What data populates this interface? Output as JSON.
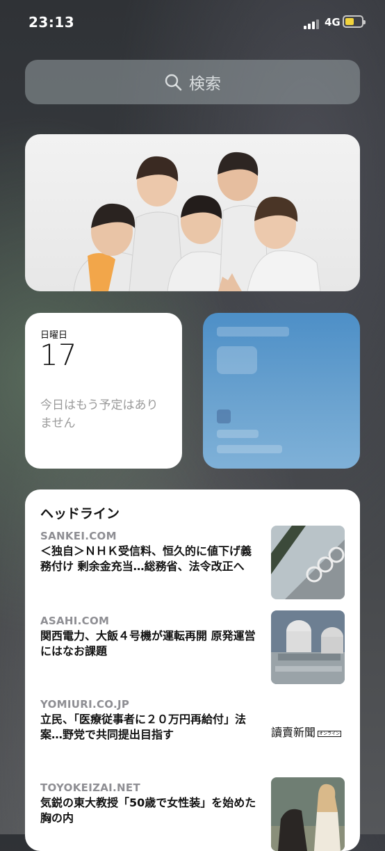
{
  "status": {
    "time": "23:13",
    "network": "4G"
  },
  "search": {
    "placeholder": "検索"
  },
  "calendar": {
    "weekday": "日曜日",
    "date": "17",
    "empty_text": "今日はもう予定はありません"
  },
  "news": {
    "header": "ヘッドライン",
    "items": [
      {
        "source": "SANKEI.COM",
        "title": "＜独自＞ＮＨＫ受信料、恒久的に値下げ義務付け 剰余金充当…総務省、法令改正へ"
      },
      {
        "source": "ASAHI.COM",
        "title": "関西電力、大飯４号機が運転再開 原発運営にはなお課題"
      },
      {
        "source": "YOMIURI.CO.JP",
        "title": "立民、「医療従事者に２０万円再給付」法案…野党で共同提出目指す",
        "logo_text": "讀賣新聞",
        "logo_tag": "オンライン"
      },
      {
        "source": "TOYOKEIZAI.NET",
        "title": "気鋭の東大教授「50歳で女性装」を始めた胸の内"
      }
    ]
  },
  "colors": {
    "battery": "#f2d43c",
    "widget_blue": "#4d8fc7"
  }
}
